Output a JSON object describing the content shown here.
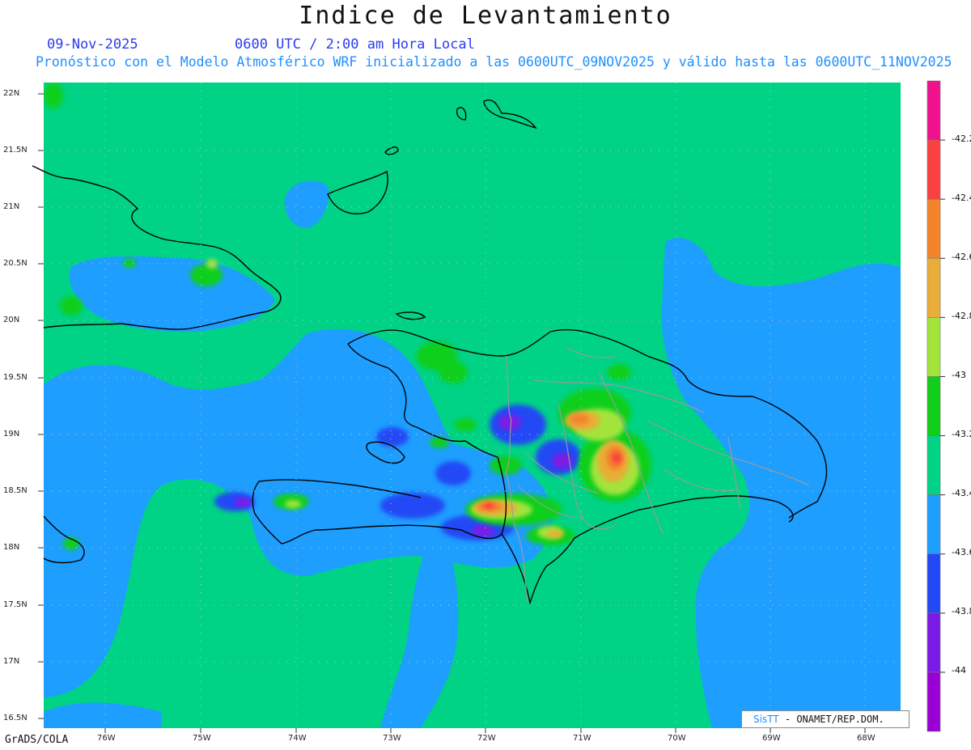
{
  "title": "Indice de Levantamiento",
  "date": "09-Nov-2025",
  "time_label": "0600 UTC / 2:00 am Hora Local",
  "run_info": "Pronóstico con el Modelo Atmosférico WRF inicializado a las 0600UTC_09NOV2025 y válido hasta las  0600UTC_11NOV2025",
  "lat_labels": [
    "22N",
    "21.5N",
    "21N",
    "20.5N",
    "20N",
    "19.5N",
    "19N",
    "18.5N",
    "18N",
    "17.5N",
    "17N",
    "16.5N"
  ],
  "lon_labels": [
    "76W",
    "75W",
    "74W",
    "73W",
    "72W",
    "71W",
    "70W",
    "69W",
    "68W"
  ],
  "colorbar": {
    "labels": [
      "-42.2",
      "-42.4",
      "-42.6",
      "-42.8",
      "-43",
      "-43.2",
      "-43.4",
      "-43.6",
      "-43.8",
      "-44"
    ],
    "colors": [
      "#f0118f",
      "#fb4040",
      "#f5832a",
      "#e9ad38",
      "#a3e43a",
      "#0fcf1a",
      "#00d286",
      "#1e9eff",
      "#2348f5",
      "#7b1ae5",
      "#9a00d6"
    ]
  },
  "credit_brand": "SisTT",
  "credit_text": " - ONAMET/REP.DOM.",
  "software": "GrADS/COLA"
}
